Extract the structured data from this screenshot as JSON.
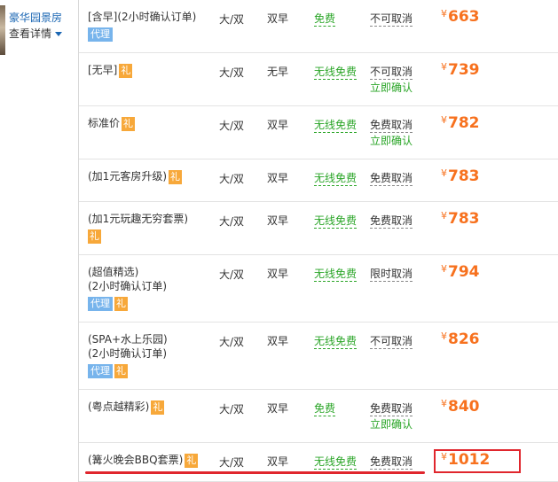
{
  "room": {
    "name": "豪华园景房",
    "detail_link": "查看详情"
  },
  "tags": {
    "agent": "代理",
    "gift": "礼"
  },
  "rows": [
    {
      "name_lines": [
        "[含早](2小时确认订单)"
      ],
      "agent": true,
      "gift": false,
      "gift_inline": false,
      "bed": "大/双",
      "breakfast": "双早",
      "net": "免费",
      "cancel": "不可取消",
      "confirm": "",
      "price": "663"
    },
    {
      "name_lines": [
        "[无早]"
      ],
      "agent": false,
      "gift": true,
      "gift_inline": true,
      "bed": "大/双",
      "breakfast": "无早",
      "net": "无线免费",
      "cancel": "不可取消",
      "confirm": "立即确认",
      "price": "739"
    },
    {
      "name_lines": [
        "标准价"
      ],
      "agent": false,
      "gift": true,
      "gift_inline": true,
      "bed": "大/双",
      "breakfast": "双早",
      "net": "无线免费",
      "cancel": "免费取消",
      "confirm": "立即确认",
      "price": "782"
    },
    {
      "name_lines": [
        "(加1元客房升级)"
      ],
      "agent": false,
      "gift": true,
      "gift_inline": true,
      "bed": "大/双",
      "breakfast": "双早",
      "net": "无线免费",
      "cancel": "免费取消",
      "confirm": "",
      "price": "783"
    },
    {
      "name_lines": [
        "(加1元玩趣无穷套票)"
      ],
      "agent": false,
      "gift": true,
      "gift_inline": false,
      "bed": "大/双",
      "breakfast": "双早",
      "net": "无线免费",
      "cancel": "免费取消",
      "confirm": "",
      "price": "783"
    },
    {
      "name_lines": [
        "(超值精选)",
        "(2小时确认订单)"
      ],
      "agent": true,
      "gift": true,
      "gift_inline": false,
      "bed": "大/双",
      "breakfast": "双早",
      "net": "无线免费",
      "cancel": "限时取消",
      "confirm": "",
      "price": "794"
    },
    {
      "name_lines": [
        "(SPA+水上乐园)",
        "(2小时确认订单)"
      ],
      "agent": true,
      "gift": true,
      "gift_inline": false,
      "bed": "大/双",
      "breakfast": "双早",
      "net": "无线免费",
      "cancel": "不可取消",
      "confirm": "",
      "price": "826"
    },
    {
      "name_lines": [
        "(粤点越精彩)"
      ],
      "agent": false,
      "gift": true,
      "gift_inline": true,
      "bed": "大/双",
      "breakfast": "双早",
      "net": "免费",
      "cancel": "免费取消",
      "confirm": "立即确认",
      "price": "840"
    },
    {
      "name_lines": [
        "(篝火晚会BBQ套票)"
      ],
      "agent": false,
      "gift": true,
      "gift_inline": true,
      "bed": "大/双",
      "breakfast": "双早",
      "net": "无线免费",
      "cancel": "免费取消",
      "confirm": "",
      "price": "1012"
    }
  ],
  "currency": "¥",
  "colors": {
    "price": "#f7711e",
    "net": "#2aa527",
    "link": "#1a66b3",
    "highlight": "#e0262d"
  }
}
